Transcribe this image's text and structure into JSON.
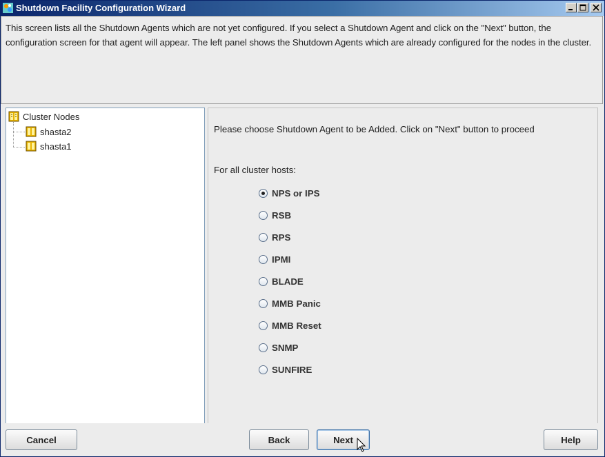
{
  "window": {
    "title": "Shutdown Facility Configuration Wizard"
  },
  "description": "This screen lists all the Shutdown Agents which are not yet configured. If you select a Shutdown Agent and click on the \"Next\" button, the configuration screen for that agent will appear. The left panel shows the Shutdown Agents which are already configured for the nodes in the cluster.",
  "tree": {
    "root": "Cluster Nodes",
    "children": [
      "shasta2",
      "shasta1"
    ]
  },
  "panel": {
    "prompt": "Please choose Shutdown Agent to be Added. Click on \"Next\" button to proceed",
    "hosts_label": "For all cluster hosts:",
    "options": [
      "NPS or IPS",
      "RSB",
      "RPS",
      "IPMI",
      "BLADE",
      "MMB Panic",
      "MMB Reset",
      "SNMP",
      "SUNFIRE"
    ],
    "selected": "NPS or IPS"
  },
  "buttons": {
    "cancel": "Cancel",
    "back": "Back",
    "next": "Next",
    "help": "Help"
  },
  "colors": {
    "titlebar_start": "#0a246a",
    "titlebar_end": "#a6caf0",
    "background": "#ececec"
  }
}
